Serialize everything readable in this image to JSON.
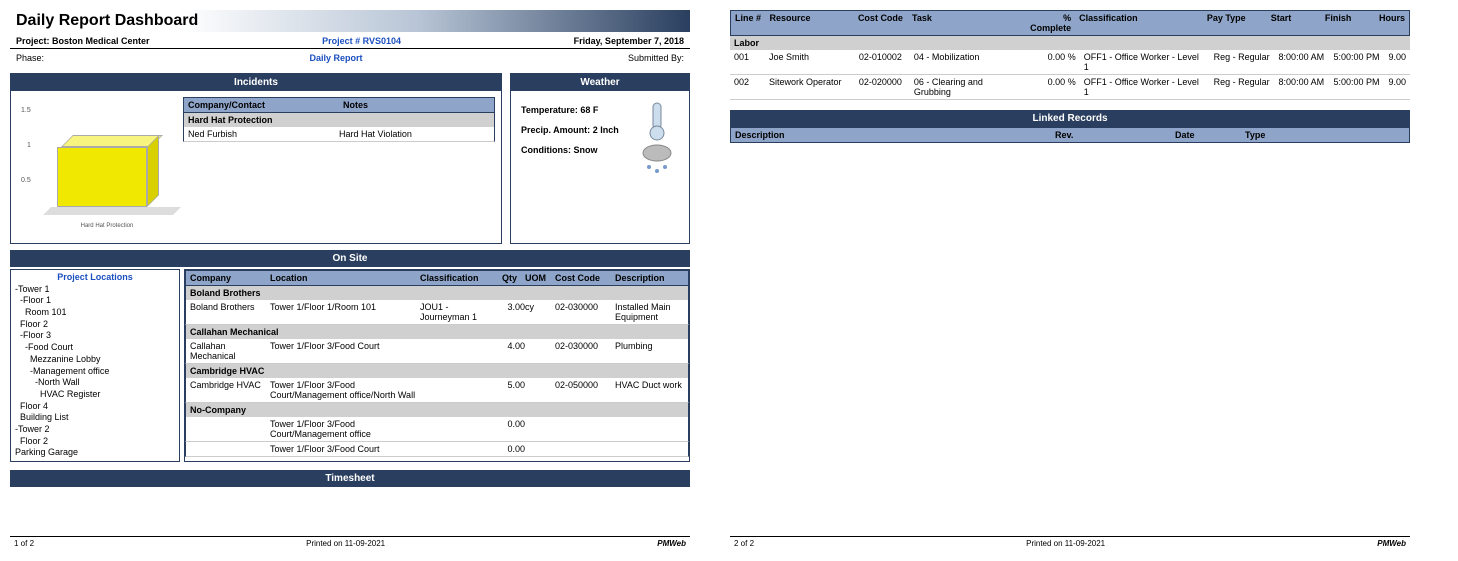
{
  "title": "Daily Report Dashboard",
  "meta": {
    "project_label": "Project:",
    "project_name": "Boston Medical Center",
    "project_num_label": "Project #",
    "project_num": "RVS0104",
    "date": "Friday, September 7, 2018",
    "phase_label": "Phase:",
    "center_link": "Daily Report",
    "submitted_label": "Submitted By:"
  },
  "incidents": {
    "header": "Incidents",
    "col_company": "Company/Contact",
    "col_notes": "Notes",
    "group": "Hard Hat Protection",
    "row_company": "Ned Furbish",
    "row_notes": "Hard Hat Violation",
    "chart_label": "Hard Hat Protection"
  },
  "chart_data": {
    "type": "bar",
    "categories": [
      "Hard Hat Protection"
    ],
    "values": [
      1
    ],
    "title": "",
    "xlabel": "",
    "ylabel": "",
    "ylim": [
      0,
      1.5
    ],
    "yticks": [
      0.5,
      1,
      1.5
    ]
  },
  "weather": {
    "header": "Weather",
    "temp_label": "Temperature:",
    "temp_value": "68 F",
    "precip_label": "Precip. Amount:",
    "precip_value": "2 Inch",
    "cond_label": "Conditions:",
    "cond_value": "Snow"
  },
  "onsite": {
    "header": "On Site",
    "locations_title": "Project Locations",
    "locations": [
      "-Tower 1",
      "  -Floor 1",
      "    Room 101",
      "  Floor 2",
      "  -Floor 3",
      "    -Food Court",
      "      Mezzanine Lobby",
      "      -Management office",
      "        -North Wall",
      "          HVAC Register",
      "  Floor 4",
      "  Building List",
      "-Tower 2",
      "  Floor 2",
      "Parking Garage"
    ],
    "cols": {
      "company": "Company",
      "location": "Location",
      "classification": "Classification",
      "qty": "Qty",
      "uom": "UOM",
      "costcode": "Cost Code",
      "description": "Description"
    },
    "groups": [
      {
        "name": "Boland Brothers",
        "rows": [
          {
            "company": "Boland Brothers",
            "location": "Tower 1/Floor 1/Room 101",
            "classification": "JOU1 - Journeyman 1",
            "qty": "3.00",
            "uom": "cy",
            "cost": "02-030000",
            "desc": "Installed Main Equipment"
          }
        ]
      },
      {
        "name": "Callahan Mechanical",
        "rows": [
          {
            "company": "Callahan Mechanical",
            "location": "Tower 1/Floor 3/Food Court",
            "classification": "",
            "qty": "4.00",
            "uom": "",
            "cost": "02-030000",
            "desc": "Plumbing"
          }
        ]
      },
      {
        "name": "Cambridge HVAC",
        "rows": [
          {
            "company": "Cambridge HVAC",
            "location": "Tower 1/Floor 3/Food Court/Management office/North Wall",
            "classification": "",
            "qty": "5.00",
            "uom": "",
            "cost": "02-050000",
            "desc": "HVAC Duct work"
          }
        ]
      },
      {
        "name": "No-Company",
        "rows": [
          {
            "company": "",
            "location": "Tower 1/Floor 3/Food Court/Management office",
            "classification": "",
            "qty": "0.00",
            "uom": "",
            "cost": "",
            "desc": ""
          },
          {
            "company": "",
            "location": "Tower 1/Floor 3/Food Court",
            "classification": "",
            "qty": "0.00",
            "uom": "",
            "cost": "",
            "desc": ""
          }
        ]
      }
    ]
  },
  "timesheet": {
    "header": "Timesheet",
    "cols": {
      "line": "Line #",
      "resource": "Resource",
      "cost": "Cost Code",
      "task": "Task",
      "pct": "% Complete",
      "class": "Classification",
      "pay": "Pay Type",
      "start": "Start",
      "finish": "Finish",
      "hours": "Hours"
    },
    "group": "Labor",
    "rows": [
      {
        "line": "001",
        "resource": "Joe Smith",
        "cost": "02-010002",
        "task": "04 - Mobilization",
        "pct": "0.00 %",
        "class": "OFF1 - Office Worker - Level 1",
        "pay": "Reg - Regular",
        "start": "8:00:00 AM",
        "finish": "5:00:00 PM",
        "hours": "9.00"
      },
      {
        "line": "002",
        "resource": "Sitework Operator",
        "cost": "02-020000",
        "task": "06 - Clearing and Grubbing",
        "pct": "0.00 %",
        "class": "OFF1 - Office Worker - Level 1",
        "pay": "Reg - Regular",
        "start": "8:00:00 AM",
        "finish": "5:00:00 PM",
        "hours": "9.00"
      }
    ]
  },
  "linked": {
    "header": "Linked Records",
    "cols": {
      "desc": "Description",
      "rev": "Rev.",
      "date": "Date",
      "type": "Type"
    }
  },
  "footer": {
    "page1": "1 of 2",
    "page2": "2 of 2",
    "printed": "Printed on 11-09-2021",
    "brand": "PMWeb"
  }
}
